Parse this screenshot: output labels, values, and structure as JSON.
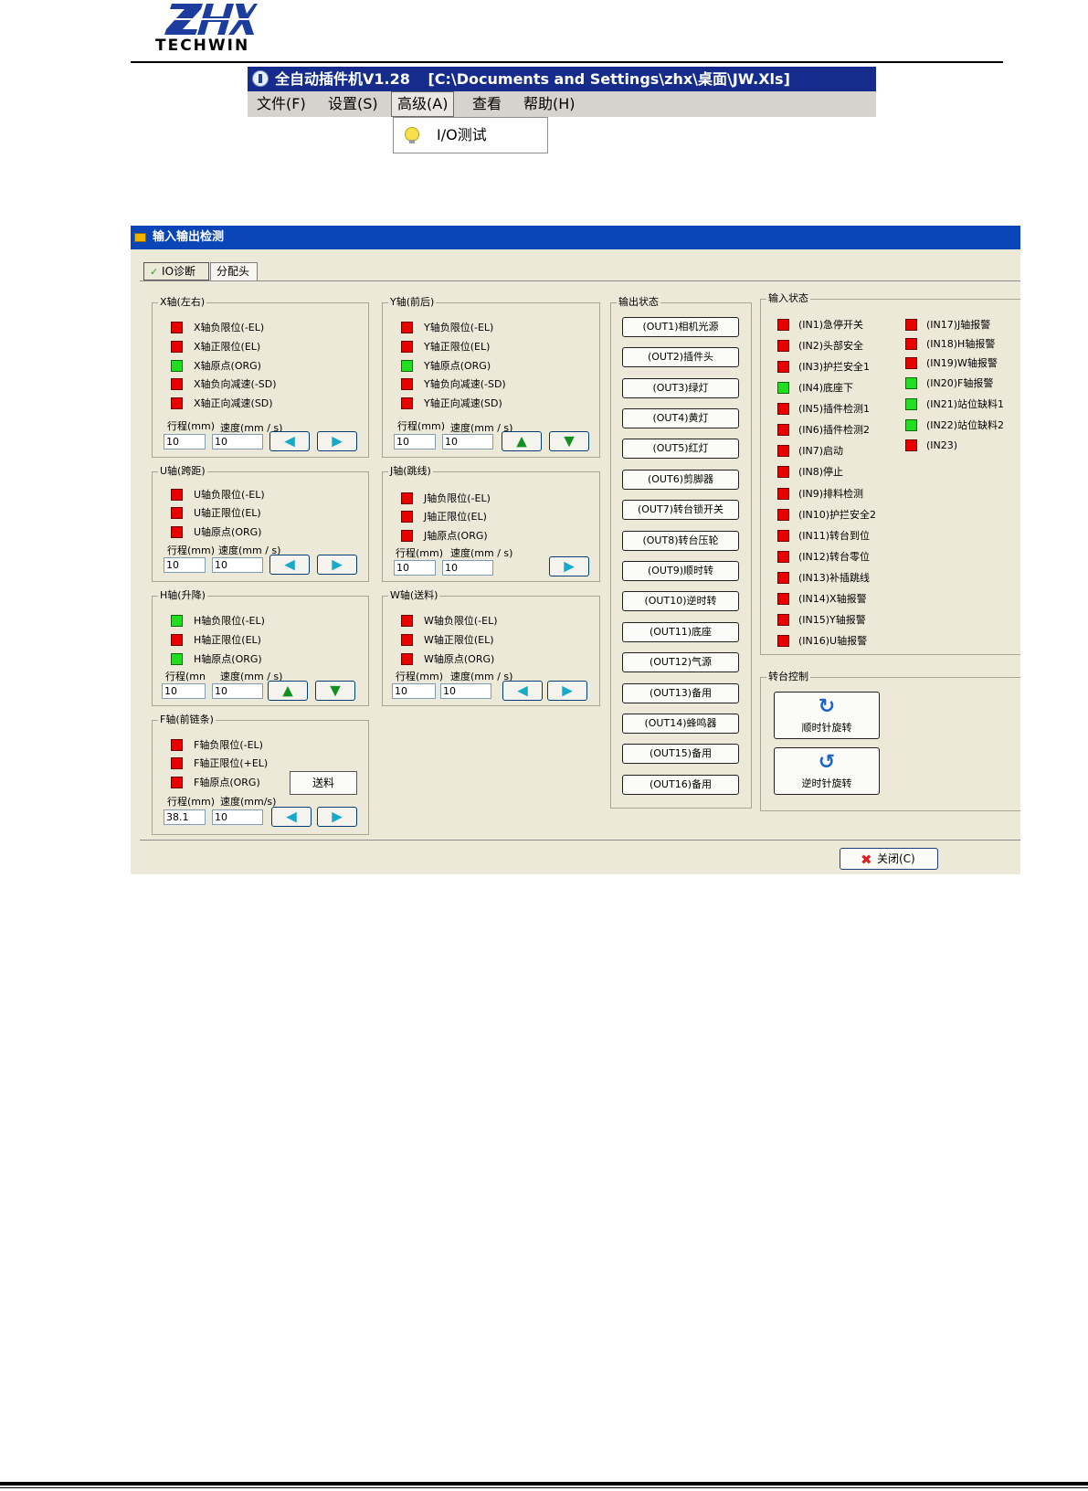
{
  "logo": {
    "brand": "ZHX",
    "sub": "TECHWIN"
  },
  "app": {
    "title": "全自动插件机V1.28",
    "path": "[C:\\Documents and Settings\\zhx\\桌面\\JW.Xls]",
    "menus": [
      "文件(F)",
      "设置(S)",
      "高级(A)",
      "查看",
      "帮助(H)"
    ],
    "dropdown_item": "I/O测试"
  },
  "dialog": {
    "title": "输入输出检测",
    "tabs": [
      "IO诊断",
      "分配头"
    ],
    "close_label": "关闭(C)",
    "labels": {
      "stroke": "行程(mm)",
      "speed": "速度(mm / s)",
      "speed_f": "速度(mm/s)"
    },
    "x_axis": {
      "title": "X轴(左右)",
      "items": [
        {
          "label": "X轴负限位(-EL)",
          "state": "red"
        },
        {
          "label": "X轴正限位(EL)",
          "state": "red"
        },
        {
          "label": "X轴原点(ORG)",
          "state": "green"
        },
        {
          "label": "X轴负向减速(-SD)",
          "state": "red"
        },
        {
          "label": "X轴正向减速(SD)",
          "state": "red"
        }
      ],
      "stroke": "10",
      "speed": "10"
    },
    "y_axis": {
      "title": "Y轴(前后)",
      "items": [
        {
          "label": "Y轴负限位(-EL)",
          "state": "red"
        },
        {
          "label": "Y轴正限位(EL)",
          "state": "red"
        },
        {
          "label": "Y轴原点(ORG)",
          "state": "green"
        },
        {
          "label": "Y轴负向减速(-SD)",
          "state": "red"
        },
        {
          "label": "Y轴正向减速(SD)",
          "state": "red"
        }
      ],
      "stroke": "10",
      "speed": "10"
    },
    "u_axis": {
      "title": "U轴(跨距)",
      "items": [
        {
          "label": "U轴负限位(-EL)",
          "state": "red"
        },
        {
          "label": "U轴正限位(EL)",
          "state": "red"
        },
        {
          "label": "U轴原点(ORG)",
          "state": "red"
        }
      ],
      "stroke": "10",
      "speed": "10"
    },
    "j_axis": {
      "title": "J轴(跳线)",
      "items": [
        {
          "label": "J轴负限位(-EL)",
          "state": "red"
        },
        {
          "label": "J轴正限位(EL)",
          "state": "red"
        },
        {
          "label": "J轴原点(ORG)",
          "state": "red"
        }
      ],
      "stroke": "10",
      "speed": "10"
    },
    "h_axis": {
      "title": "H轴(升降)",
      "items": [
        {
          "label": "H轴负限位(-EL)",
          "state": "green"
        },
        {
          "label": "H轴正限位(EL)",
          "state": "red"
        },
        {
          "label": "H轴原点(ORG)",
          "state": "green"
        }
      ],
      "stroke": "10",
      "speed": "10",
      "stroke_label": "行程(mn"
    },
    "w_axis": {
      "title": "W轴(送料)",
      "items": [
        {
          "label": "W轴负限位(-EL)",
          "state": "red"
        },
        {
          "label": "W轴正限位(EL)",
          "state": "red"
        },
        {
          "label": "W轴原点(ORG)",
          "state": "red"
        }
      ],
      "stroke": "10",
      "speed": "10"
    },
    "f_axis": {
      "title": "F轴(前链条)",
      "items": [
        {
          "label": "F轴负限位(-EL)",
          "state": "red"
        },
        {
          "label": "F轴正限位(+EL)",
          "state": "red"
        },
        {
          "label": "F轴原点(ORG)",
          "state": "red"
        }
      ],
      "stroke": "38.1",
      "speed": "10",
      "feed_label": "送料"
    },
    "output": {
      "title": "输出状态",
      "buttons": [
        "(OUT1)相机光源",
        "(OUT2)插件头",
        "(OUT3)绿灯",
        "(OUT4)黄灯",
        "(OUT5)红灯",
        "(OUT6)剪脚器",
        "(OUT7)转台锁开关",
        "(OUT8)转台压轮",
        "(OUT9)顺时转",
        "(OUT10)逆时转",
        "(OUT11)底座",
        "(OUT12)气源",
        "(OUT13)备用",
        "(OUT14)蜂鸣器",
        "(OUT15)备用",
        "(OUT16)备用"
      ]
    },
    "input": {
      "title": "输入状态",
      "col1": [
        {
          "label": "(IN1)急停开关",
          "state": "red"
        },
        {
          "label": "(IN2)头部安全",
          "state": "red"
        },
        {
          "label": "(IN3)护拦安全1",
          "state": "red"
        },
        {
          "label": "(IN4)底座下",
          "state": "green"
        },
        {
          "label": "(IN5)插件检测1",
          "state": "red"
        },
        {
          "label": "(IN6)插件检测2",
          "state": "red"
        },
        {
          "label": "(IN7)启动",
          "state": "red"
        },
        {
          "label": "(IN8)停止",
          "state": "red"
        },
        {
          "label": "(IN9)排料检测",
          "state": "red"
        },
        {
          "label": "(IN10)护拦安全2",
          "state": "red"
        },
        {
          "label": "(IN11)转台到位",
          "state": "red"
        },
        {
          "label": "(IN12)转台零位",
          "state": "red"
        },
        {
          "label": "(IN13)补插跳线",
          "state": "red"
        },
        {
          "label": "(IN14)X轴报警",
          "state": "red"
        },
        {
          "label": "(IN15)Y轴报警",
          "state": "red"
        },
        {
          "label": "(IN16)U轴报警",
          "state": "red"
        }
      ],
      "col2": [
        {
          "label": "(IN17)J轴报警",
          "state": "red"
        },
        {
          "label": "(IN18)H轴报警",
          "state": "red"
        },
        {
          "label": "(IN19)W轴报警",
          "state": "red"
        },
        {
          "label": "(IN20)F轴报警",
          "state": "green"
        },
        {
          "label": "(IN21)站位缺料1",
          "state": "green"
        },
        {
          "label": "(IN22)站位缺料2",
          "state": "green"
        },
        {
          "label": "(IN23)",
          "state": "red"
        }
      ]
    },
    "turntable": {
      "title": "转台控制",
      "cw": "顺时针旋转",
      "ccw": "逆时针旋转"
    }
  }
}
